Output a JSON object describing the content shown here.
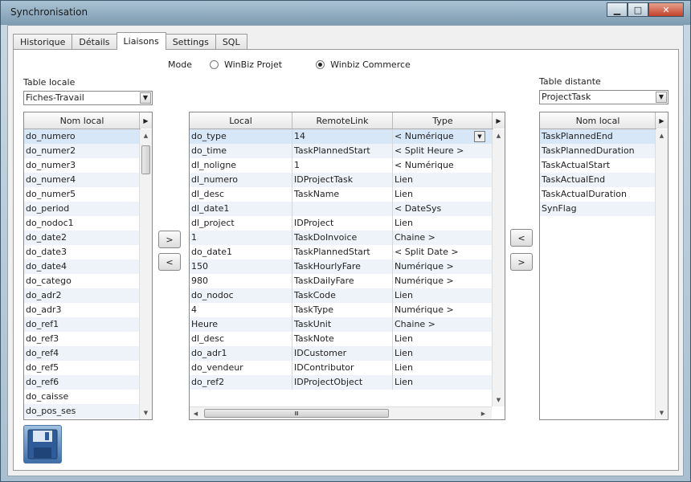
{
  "window": {
    "title": "Synchronisation",
    "minimize": "▁",
    "maximize": "□",
    "close": "✕"
  },
  "tabs": [
    "Historique",
    "Détails",
    "Liaisons",
    "Settings",
    "SQL"
  ],
  "active_tab": "Liaisons",
  "mode": {
    "label": "Mode",
    "options": [
      "WinBiz Projet",
      "Winbiz Commerce"
    ],
    "selected": "Winbiz Commerce"
  },
  "left": {
    "label": "Table locale",
    "table_value": "Fiches-Travail",
    "header": "Nom local",
    "items": [
      "do_numero",
      "do_numer2",
      "do_numer3",
      "do_numer4",
      "do_numer5",
      "do_period",
      "do_nodoc1",
      "do_date2",
      "do_date3",
      "do_date4",
      "do_catego",
      "do_adr2",
      "do_adr3",
      "do_ref1",
      "do_ref3",
      "do_ref4",
      "do_ref5",
      "do_ref6",
      "do_caisse",
      "do_pos_ses"
    ]
  },
  "center": {
    "headers": [
      "Local",
      "RemoteLink",
      "Type"
    ],
    "rows": [
      [
        "do_type",
        "14",
        "< Numérique"
      ],
      [
        "do_time",
        "TaskPlannedStart",
        "< Split Heure >"
      ],
      [
        "dl_noligne",
        "1",
        "< Numérique"
      ],
      [
        "dl_numero",
        "IDProjectTask",
        "Lien"
      ],
      [
        "dl_desc",
        "TaskName",
        "Lien"
      ],
      [
        "dl_date1",
        "",
        "< DateSys"
      ],
      [
        "dl_project",
        "IDProject",
        "Lien"
      ],
      [
        "1",
        "TaskDoInvoice",
        "Chaine      >"
      ],
      [
        "do_date1",
        "TaskPlannedStart",
        "< Split Date >"
      ],
      [
        "150",
        "TaskHourlyFare",
        "Numérique >"
      ],
      [
        "980",
        "TaskDailyFare",
        "Numérique >"
      ],
      [
        "do_nodoc",
        "TaskCode",
        "Lien"
      ],
      [
        "4",
        "TaskType",
        "Numérique >"
      ],
      [
        "Heure",
        "TaskUnit",
        "Chaine      >"
      ],
      [
        "dl_desc",
        "TaskNote",
        "Lien"
      ],
      [
        "do_adr1",
        "IDCustomer",
        "Lien"
      ],
      [
        "do_vendeur",
        "IDContributor",
        "Lien"
      ],
      [
        "do_ref2",
        "IDProjectObject",
        "Lien"
      ]
    ]
  },
  "right": {
    "label": "Table distante",
    "table_value": "ProjectTask",
    "header": "Nom local",
    "items": [
      "TaskPlannedEnd",
      "TaskPlannedDuration",
      "TaskActualStart",
      "TaskActualEnd",
      "TaskActualDuration",
      "SynFlag"
    ]
  },
  "buttons": {
    "add": ">",
    "remove": "<",
    "right_add": "<",
    "right_remove": ">"
  },
  "icons": {
    "dropdown": "▼",
    "header_more": "▶",
    "scroll_up": "▲",
    "scroll_down": "▼",
    "scroll_left": "◀",
    "scroll_right": "▶",
    "hscroll_grip": "Ⅲ"
  }
}
